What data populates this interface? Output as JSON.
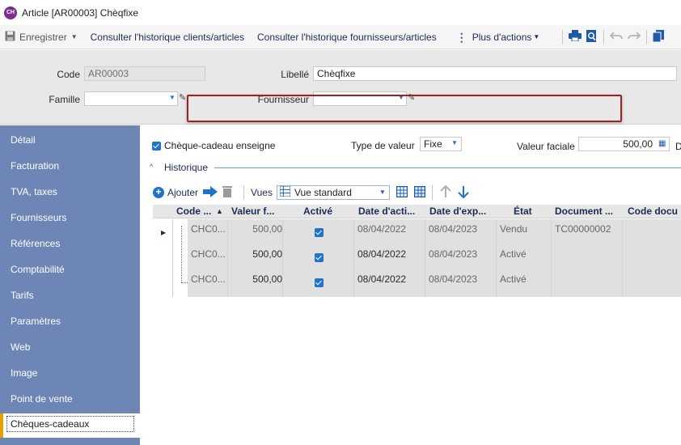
{
  "window": {
    "app_icon": "CH",
    "title": "Article [AR00003] Chèqfixe"
  },
  "toolbar": {
    "save_label": "Enregistrer",
    "history_clients_label": "Consulter l'historique clients/articles",
    "history_suppliers_label": "Consulter l'historique fournisseurs/articles",
    "more_actions_label": "Plus d'actions"
  },
  "header": {
    "code_label": "Code",
    "code_value": "AR00003",
    "libelle_label": "Libellé",
    "libelle_value": "Chèqfixe",
    "famille_label": "Famille",
    "famille_value": "",
    "fournisseur_label": "Fournisseur",
    "fournisseur_value": ""
  },
  "sidebar": {
    "items": [
      {
        "label": "Détail"
      },
      {
        "label": "Facturation"
      },
      {
        "label": "TVA, taxes"
      },
      {
        "label": "Fournisseurs"
      },
      {
        "label": "Références"
      },
      {
        "label": "Comptabilité"
      },
      {
        "label": "Tarifs"
      },
      {
        "label": "Paramètres"
      },
      {
        "label": "Web"
      },
      {
        "label": "Image"
      },
      {
        "label": "Point de vente"
      },
      {
        "label": "Chèques-cadeaux"
      }
    ],
    "active_index": 11
  },
  "main": {
    "voucher_checkbox_label": "Chèque-cadeau enseigne",
    "voucher_checked": true,
    "type_valeur_label": "Type de valeur",
    "type_valeur_value": "Fixe",
    "valeur_faciale_label": "Valeur faciale",
    "valeur_faciale_value": "500,00",
    "cut_label": "D",
    "historique_label": "Historique",
    "add_label": "Ajouter",
    "views_label": "Vues",
    "view_value": "Vue standard"
  },
  "grid": {
    "columns": [
      "Code ...",
      "Valeur f...",
      "Activé",
      "Date d'acti...",
      "Date d'exp...",
      "État",
      "Document ...",
      "Code docu"
    ],
    "rows": [
      {
        "code": "CHC0...",
        "valeur": "500,00",
        "active": true,
        "date_activation": "08/04/2022",
        "date_expiration": "08/04/2023",
        "etat": "Vendu",
        "document": "TC00000002",
        "code_doc": ""
      },
      {
        "code": "CHC0...",
        "valeur": "500,00",
        "active": true,
        "date_activation": "08/04/2022",
        "date_expiration": "08/04/2023",
        "etat": "Activé",
        "document": "",
        "code_doc": ""
      },
      {
        "code": "CHC0...",
        "valeur": "500,00",
        "active": true,
        "date_activation": "08/04/2022",
        "date_expiration": "08/04/2023",
        "etat": "Activé",
        "document": "",
        "code_doc": ""
      }
    ]
  },
  "colors": {
    "sidebar_bg": "#6e86b5",
    "accent_blue": "#1f73c9",
    "highlight_border": "#9b2423",
    "active_marker": "#e8a000"
  }
}
